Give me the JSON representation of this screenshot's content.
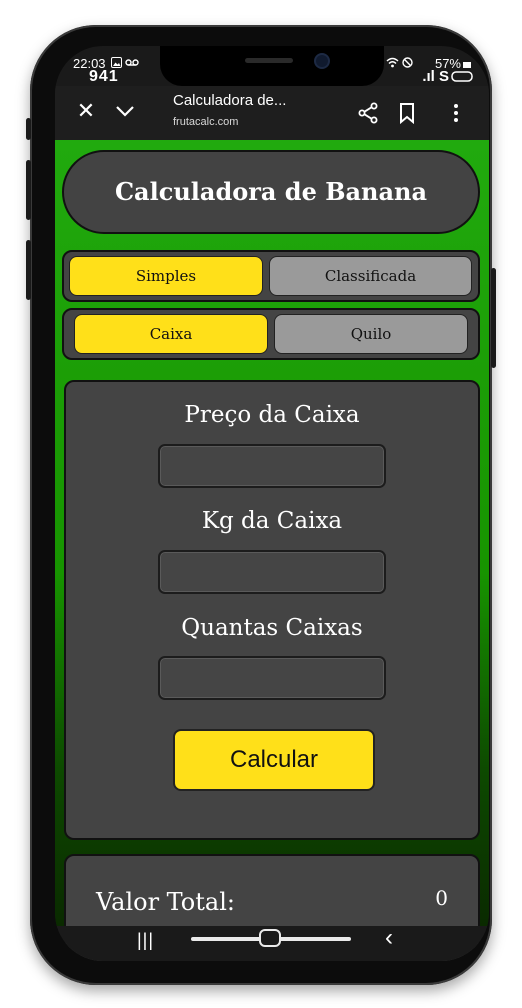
{
  "status_bar": {
    "time": "22:03",
    "carrier": "941",
    "battery": "57%",
    "signal_text": ".ıl S"
  },
  "browser": {
    "page_title": "Calculadora de...",
    "url": "frutacalc.com"
  },
  "app": {
    "title": "Calculadora de Banana",
    "mode_tabs": [
      {
        "label": "Simples",
        "active": true
      },
      {
        "label": "Classificada",
        "active": false
      }
    ],
    "unit_tabs": [
      {
        "label": "Caixa",
        "active": true
      },
      {
        "label": "Quilo",
        "active": false
      }
    ],
    "fields": [
      {
        "label": "Preço da Caixa",
        "value": ""
      },
      {
        "label": "Kg da Caixa",
        "value": ""
      },
      {
        "label": "Quantas Caixas",
        "value": ""
      }
    ],
    "calculate_label": "Calcular",
    "result": {
      "label": "Valor Total:",
      "value": "0"
    }
  },
  "colors": {
    "accent_yellow": "#ffe019",
    "panel_gray": "#444444",
    "background_green": "#21aa0e",
    "inactive_tab": "#9a9a9a"
  }
}
